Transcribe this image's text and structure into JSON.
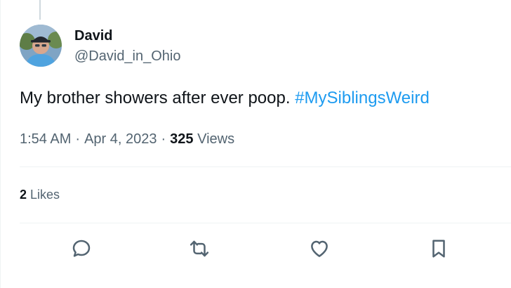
{
  "author": {
    "display_name": "David",
    "handle": "@David_in_Ohio"
  },
  "tweet": {
    "text": "My brother showers after ever poop.",
    "hashtag": "#MySiblingsWeird"
  },
  "meta": {
    "time": "1:54 AM",
    "separator": "·",
    "date": "Apr 4, 2023",
    "views_count": "325",
    "views_label": "Views"
  },
  "engagement": {
    "likes_count": "2",
    "likes_label": "Likes"
  },
  "actions": [
    {
      "name": "reply",
      "icon": "reply-icon"
    },
    {
      "name": "retweet",
      "icon": "retweet-icon"
    },
    {
      "name": "like",
      "icon": "heart-icon"
    },
    {
      "name": "bookmark",
      "icon": "bookmark-icon"
    }
  ],
  "colors": {
    "text_primary": "#0f1419",
    "text_secondary": "#536471",
    "accent": "#1d9bf0",
    "divider": "#eff3f4"
  }
}
